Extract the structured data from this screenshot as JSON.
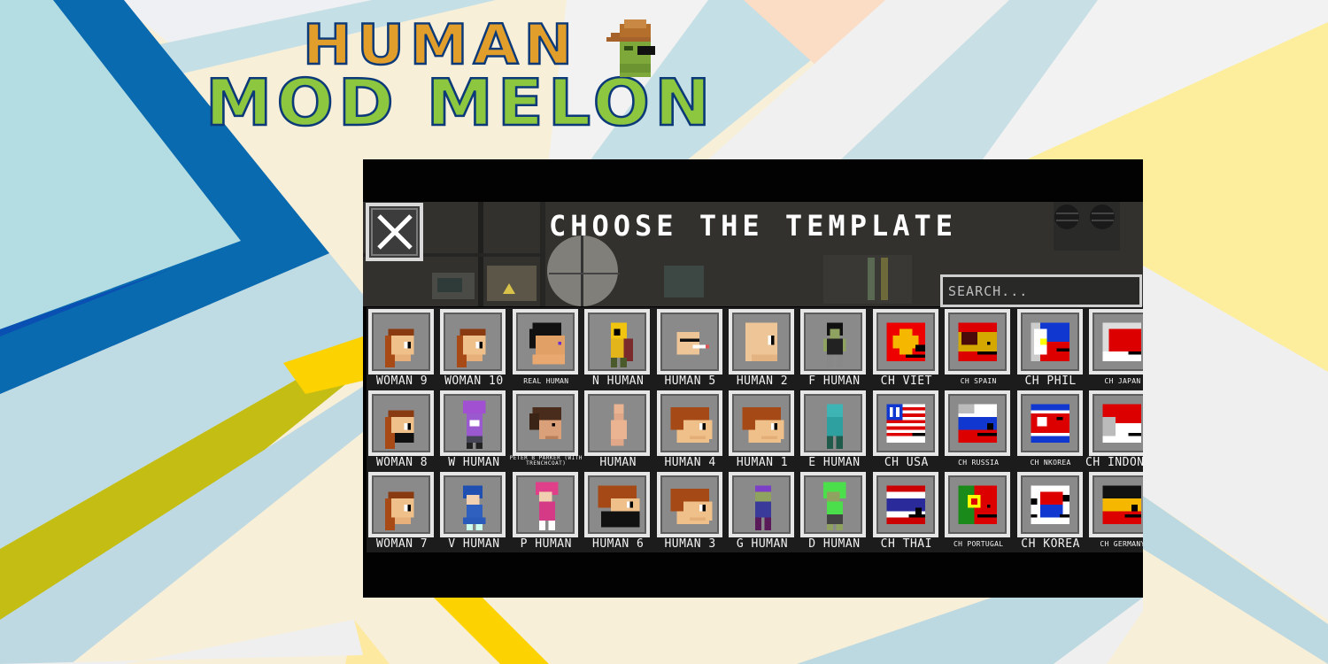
{
  "logo": {
    "line1": "HUMAN",
    "line2": "MOD MELON",
    "mascot_icon": "melon-cowboy-hat-icon"
  },
  "colors": {
    "logo_orange": "#e19e2a",
    "logo_green": "#8dc63f",
    "logo_outline": "#0c3a78",
    "screen_bg": "#020202",
    "tile_bg": "#8a8a8a",
    "tile_border": "#e6e6e6",
    "label_text": "#f2f2f2"
  },
  "screen": {
    "title": "CHOOSE THE TEMPLATE",
    "close_icon": "close-x-icon",
    "search": {
      "placeholder": "SEARCH...",
      "value": ""
    }
  },
  "templates": {
    "rows": [
      [
        {
          "label": "WOMAN 9",
          "icon": "woman-head-icon",
          "size": "normal"
        },
        {
          "label": "WOMAN 10",
          "icon": "woman-head-icon",
          "size": "normal"
        },
        {
          "label": "REAL HUMAN",
          "icon": "real-human-head-icon",
          "size": "small"
        },
        {
          "label": "N HUMAN",
          "icon": "character-n-icon",
          "size": "normal"
        },
        {
          "label": "HUMAN 5",
          "icon": "smoking-head-icon",
          "size": "normal"
        },
        {
          "label": "HUMAN 2",
          "icon": "bald-head-icon",
          "size": "normal"
        },
        {
          "label": "F HUMAN",
          "icon": "character-f-icon",
          "size": "normal"
        },
        {
          "label": "CH VIET",
          "icon": "vietnam-countryball-icon",
          "size": "normal"
        },
        {
          "label": "CH SPAIN",
          "icon": "spain-countryball-icon",
          "size": "small"
        },
        {
          "label": "CH PHIL",
          "icon": "philippines-countryball-icon",
          "size": "normal"
        },
        {
          "label": "CH JAPAN",
          "icon": "japan-countryball-icon",
          "size": "small"
        }
      ],
      [
        {
          "label": "WOMAN 8",
          "icon": "masked-woman-head-icon",
          "size": "normal"
        },
        {
          "label": "W HUMAN",
          "icon": "character-w-icon",
          "size": "normal"
        },
        {
          "label": "PETER B PARKER (WITH TRENCHCOAT)",
          "icon": "peter-parker-head-icon",
          "size": "tiny"
        },
        {
          "label": "HUMAN",
          "icon": "human-body-icon",
          "size": "normal"
        },
        {
          "label": "HUMAN 4",
          "icon": "boy-head-icon",
          "size": "normal"
        },
        {
          "label": "HUMAN 1",
          "icon": "boy-head-icon",
          "size": "normal"
        },
        {
          "label": "E HUMAN",
          "icon": "character-e-icon",
          "size": "normal"
        },
        {
          "label": "CH USA",
          "icon": "usa-countryball-icon",
          "size": "normal"
        },
        {
          "label": "CH RUSSIA",
          "icon": "russia-countryball-icon",
          "size": "small"
        },
        {
          "label": "CH NKOREA",
          "icon": "north-korea-countryball-icon",
          "size": "small"
        },
        {
          "label": "CH INDONESIA",
          "icon": "indonesia-countryball-icon",
          "size": "normal"
        }
      ],
      [
        {
          "label": "WOMAN 7",
          "icon": "woman-head-icon",
          "size": "normal"
        },
        {
          "label": "V HUMAN",
          "icon": "character-v-icon",
          "size": "normal"
        },
        {
          "label": "P HUMAN",
          "icon": "character-p-icon",
          "size": "normal"
        },
        {
          "label": "HUMAN 6",
          "icon": "masked-boy-head-icon",
          "size": "normal"
        },
        {
          "label": "HUMAN 3",
          "icon": "boy-head-icon",
          "size": "normal"
        },
        {
          "label": "G HUMAN",
          "icon": "character-g-icon",
          "size": "normal"
        },
        {
          "label": "D HUMAN",
          "icon": "character-d-icon",
          "size": "normal"
        },
        {
          "label": "CH THAI",
          "icon": "thailand-countryball-icon",
          "size": "normal"
        },
        {
          "label": "CH PORTUGAL",
          "icon": "portugal-countryball-icon",
          "size": "small"
        },
        {
          "label": "CH KOREA",
          "icon": "south-korea-countryball-icon",
          "size": "normal"
        },
        {
          "label": "CH GERMANY",
          "icon": "germany-countryball-icon",
          "size": "small"
        }
      ]
    ]
  }
}
